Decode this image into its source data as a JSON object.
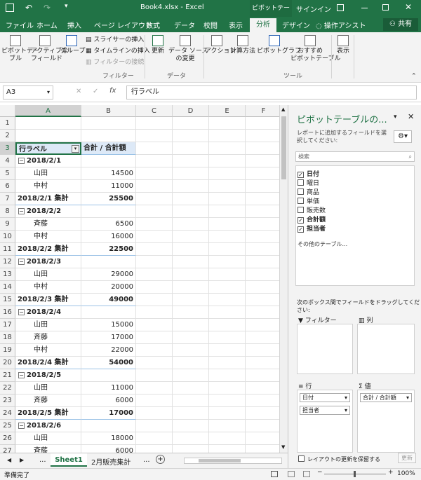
{
  "window": {
    "file_title": "Book4.xlsx - Excel",
    "context_tab": "ピボットテーブ...",
    "signin": "サインイン"
  },
  "ribbon": {
    "tabs": [
      "ファイル",
      "ホーム",
      "挿入",
      "ページ レイアウト",
      "数式",
      "データ",
      "校閲",
      "表示",
      "分析",
      "デザイン"
    ],
    "active_tab": "分析",
    "tell_me": "操作アシスト",
    "share": "共有",
    "buttons": {
      "pivot_table": "ピボットテー\nブル",
      "active_field": "アクティブな\nフィールド",
      "group": "グループ",
      "insert_slicer": "スライサーの挿入",
      "insert_timeline": "タイムラインの挿入",
      "filter_connections": "フィルターの接続",
      "refresh": "更新",
      "change_source": "データ ソース\nの変更",
      "actions": "アクション",
      "calculations": "計算方法",
      "pivot_chart": "ピボットグラフ",
      "recommended": "おすすめ\nピボットテーブル",
      "show": "表示"
    },
    "groups": {
      "filter": "フィルター",
      "data": "データ",
      "tools": "ツール"
    }
  },
  "formula_bar": {
    "name_box": "A3",
    "fx": "fx",
    "content": "行ラベル"
  },
  "columns": [
    "A",
    "B",
    "C",
    "D",
    "E",
    "F"
  ],
  "rows": [
    {
      "n": "1",
      "a": "",
      "b": "",
      "type": "blank"
    },
    {
      "n": "2",
      "a": "",
      "b": "",
      "type": "blank"
    },
    {
      "n": "3",
      "a": "行ラベル",
      "b": "合計 / 合計額",
      "type": "header"
    },
    {
      "n": "4",
      "a": "2018/2/1",
      "b": "",
      "type": "group"
    },
    {
      "n": "5",
      "a": "山田",
      "b": "14500",
      "type": "item"
    },
    {
      "n": "6",
      "a": "中村",
      "b": "11000",
      "type": "item"
    },
    {
      "n": "7",
      "a": "2018/2/1 集計",
      "b": "25500",
      "type": "subtotal"
    },
    {
      "n": "8",
      "a": "2018/2/2",
      "b": "",
      "type": "group"
    },
    {
      "n": "9",
      "a": "斉藤",
      "b": "6500",
      "type": "item"
    },
    {
      "n": "10",
      "a": "中村",
      "b": "16000",
      "type": "item"
    },
    {
      "n": "11",
      "a": "2018/2/2 集計",
      "b": "22500",
      "type": "subtotal"
    },
    {
      "n": "12",
      "a": "2018/2/3",
      "b": "",
      "type": "group"
    },
    {
      "n": "13",
      "a": "山田",
      "b": "29000",
      "type": "item"
    },
    {
      "n": "14",
      "a": "中村",
      "b": "20000",
      "type": "item"
    },
    {
      "n": "15",
      "a": "2018/2/3 集計",
      "b": "49000",
      "type": "subtotal"
    },
    {
      "n": "16",
      "a": "2018/2/4",
      "b": "",
      "type": "group"
    },
    {
      "n": "17",
      "a": "山田",
      "b": "15000",
      "type": "item"
    },
    {
      "n": "18",
      "a": "斉藤",
      "b": "17000",
      "type": "item"
    },
    {
      "n": "19",
      "a": "中村",
      "b": "22000",
      "type": "item"
    },
    {
      "n": "20",
      "a": "2018/2/4 集計",
      "b": "54000",
      "type": "subtotal"
    },
    {
      "n": "21",
      "a": "2018/2/5",
      "b": "",
      "type": "group"
    },
    {
      "n": "22",
      "a": "山田",
      "b": "11000",
      "type": "item"
    },
    {
      "n": "23",
      "a": "斉藤",
      "b": "6000",
      "type": "item"
    },
    {
      "n": "24",
      "a": "2018/2/5 集計",
      "b": "17000",
      "type": "subtotal"
    },
    {
      "n": "25",
      "a": "2018/2/6",
      "b": "",
      "type": "group"
    },
    {
      "n": "26",
      "a": "山田",
      "b": "18000",
      "type": "item"
    },
    {
      "n": "27",
      "a": "斉藤",
      "b": "6000",
      "type": "item"
    }
  ],
  "sheets": {
    "nav_more": "...",
    "active": "Sheet1",
    "other": "2月販売集計",
    "more": "..."
  },
  "status": {
    "ready": "準備完了",
    "zoom": "100%"
  },
  "pane": {
    "title": "ピボットテーブルの...",
    "subtitle": "レポートに追加するフィールドを選択してください:",
    "search_placeholder": "検索",
    "fields": [
      {
        "label": "日付",
        "checked": true
      },
      {
        "label": "曜日",
        "checked": false
      },
      {
        "label": "商品",
        "checked": false
      },
      {
        "label": "単価",
        "checked": false
      },
      {
        "label": "販売数",
        "checked": false
      },
      {
        "label": "合計額",
        "checked": true
      },
      {
        "label": "担当者",
        "checked": true
      }
    ],
    "more_tables": "その他のテーブル...",
    "drag_hint": "次のボックス間でフィールドをドラッグしてください:",
    "filters_label": "フィルター",
    "columns_label": "列",
    "rows_label": "行",
    "values_label": "値",
    "row_fields": [
      "日付",
      "担当者"
    ],
    "value_fields": [
      "合計 / 合計額"
    ],
    "defer_label": "レイアウトの更新を保留する",
    "update_button": "更新"
  }
}
